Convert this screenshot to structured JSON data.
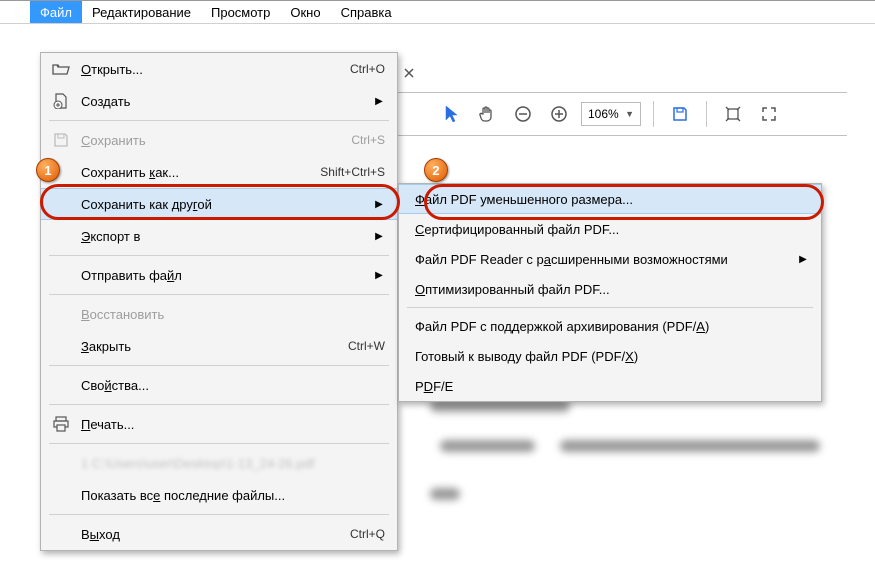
{
  "menubar": {
    "file": "Файл",
    "edit": "Редактирование",
    "view": "Просмотр",
    "window": "Окно",
    "help": "Справка"
  },
  "toolbar": {
    "zoom_value": "106%"
  },
  "file_menu": {
    "open": "Открыть...",
    "open_shortcut": "Ctrl+O",
    "create": "Создать",
    "save": "Сохранить",
    "save_shortcut": "Ctrl+S",
    "save_as": "Сохранить как...",
    "save_as_shortcut": "Shift+Ctrl+S",
    "save_as_other": "Сохранить как другой",
    "export_to": "Экспорт в",
    "send_file": "Отправить файл",
    "revert": "Восстановить",
    "close": "Закрыть",
    "close_shortcut": "Ctrl+W",
    "properties": "Свойства...",
    "print": "Печать...",
    "show_recent": "Показать все последние файлы...",
    "exit": "Выход",
    "exit_shortcut": "Ctrl+Q"
  },
  "submenu": {
    "reduced": "Файл PDF уменьшенного размера...",
    "certified": "Сертифицированный файл PDF...",
    "reader_ext": "Файл PDF Reader с расширенными возможностями",
    "optimized": "Оптимизированный файл PDF...",
    "archive": "Файл PDF с поддержкой архивирования (PDF/A)",
    "prepress": "Готовый к выводу файл PDF (PDF/X)",
    "pdfe": "PDF/E"
  },
  "callouts": {
    "one": "1",
    "two": "2"
  }
}
